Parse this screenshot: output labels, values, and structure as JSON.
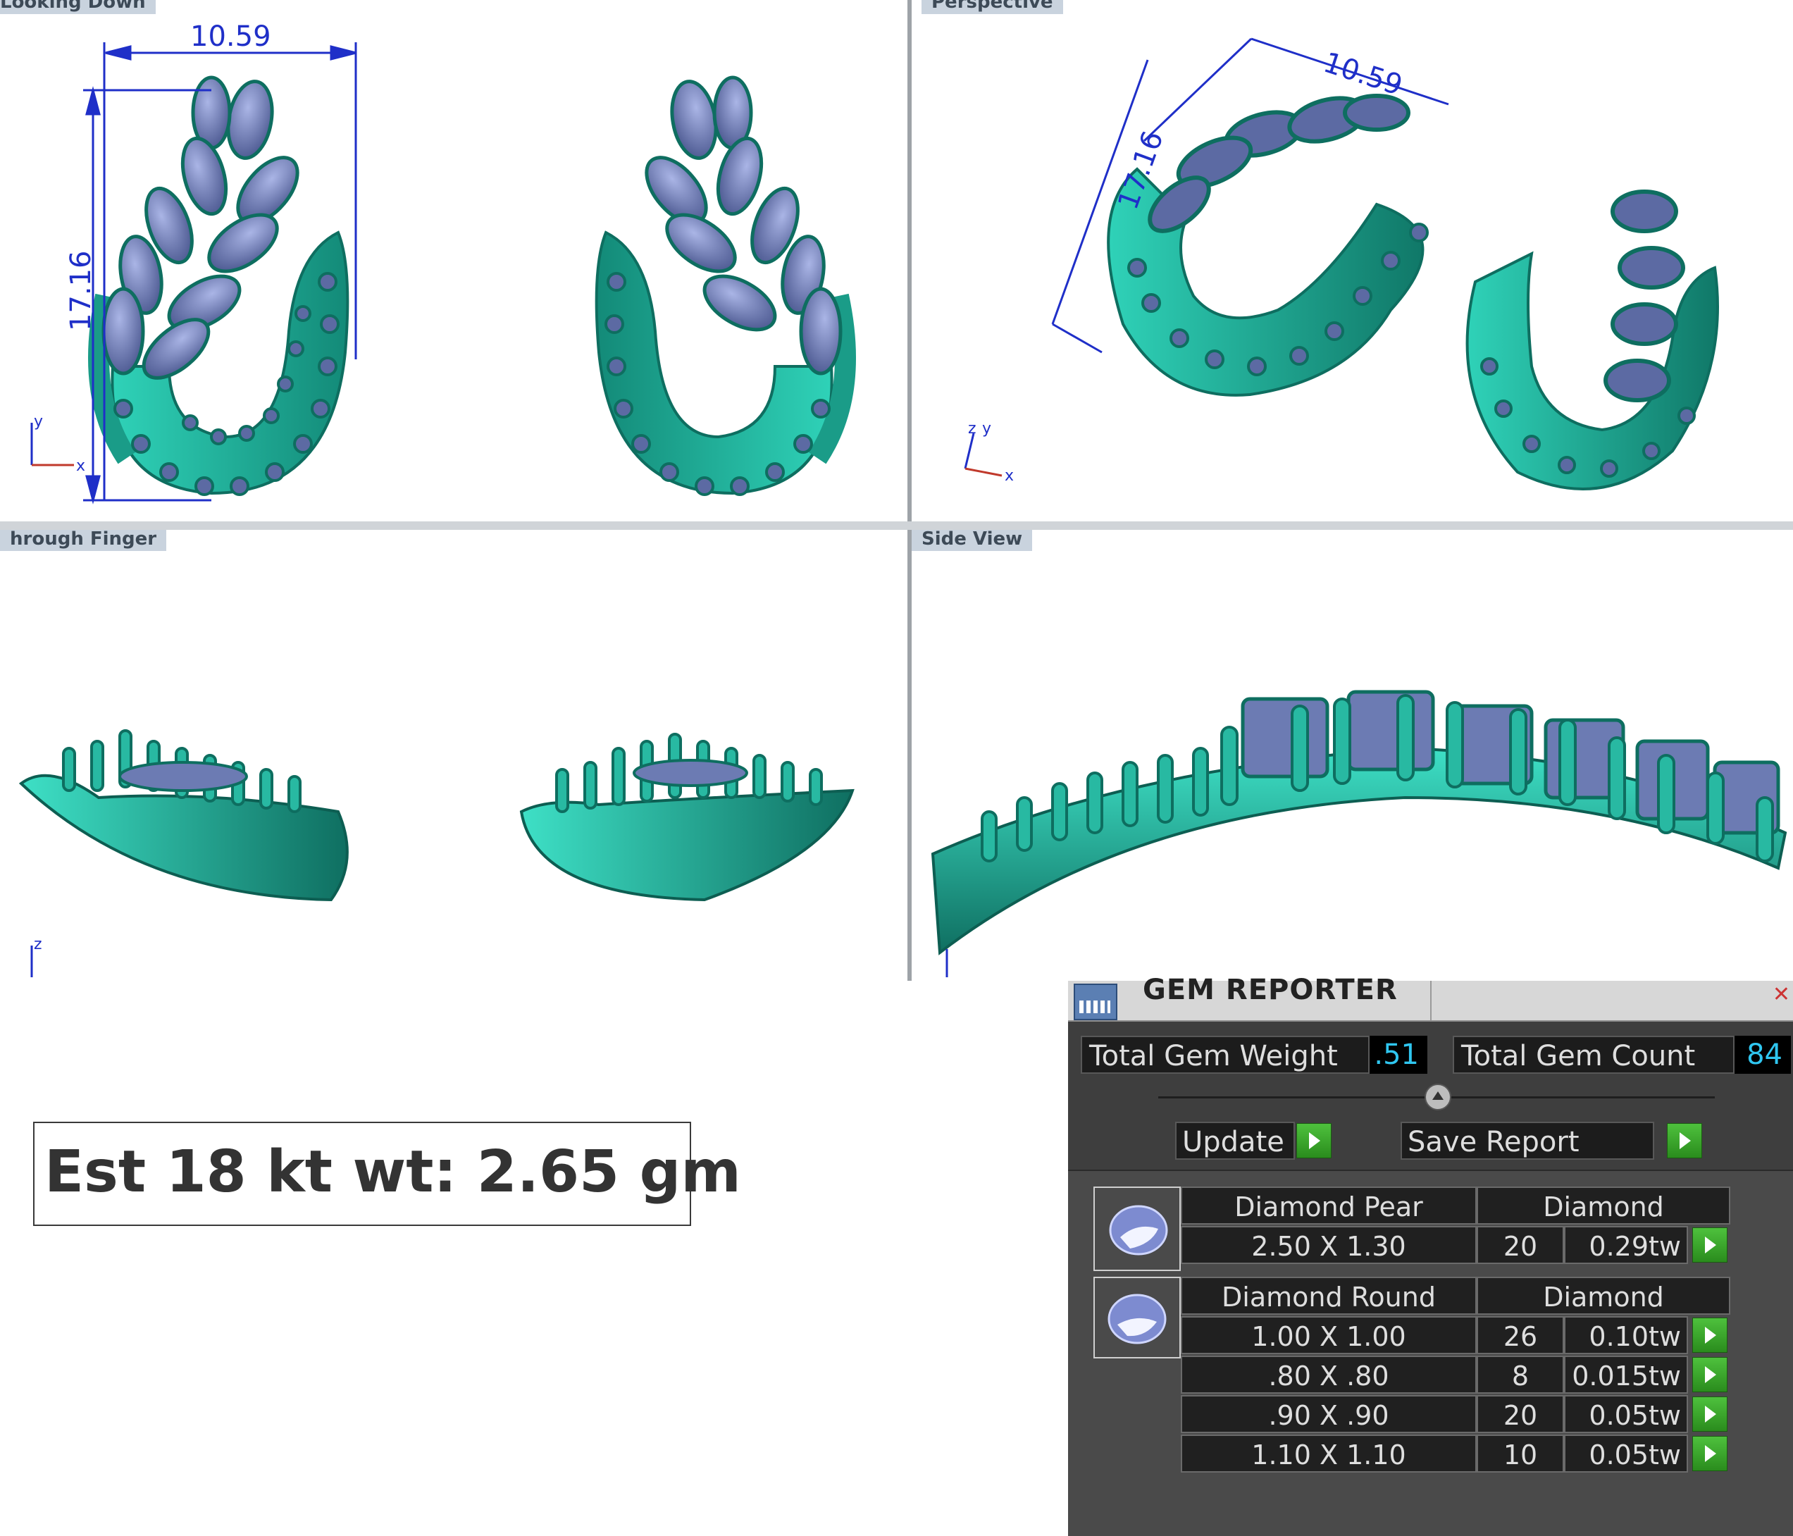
{
  "viewports": [
    {
      "id": "top-left",
      "label": "Looking Down"
    },
    {
      "id": "top-right",
      "label": "Perspective"
    },
    {
      "id": "bottom-left",
      "label": "hrough Finger"
    },
    {
      "id": "bottom-right",
      "label": "Side View"
    }
  ],
  "dimensions": {
    "width": "10.59",
    "height": "17.16"
  },
  "axes": {
    "x": "x",
    "y": "y",
    "z": "z"
  },
  "weight_text": "Est 18 kt wt: 2.65 gm",
  "gem_reporter": {
    "title": "GEM REPORTER",
    "total_weight_label": "Total Gem Weight",
    "total_weight_value": ".51",
    "total_count_label": "Total Gem Count",
    "total_count_value": "84",
    "update_label": "Update",
    "save_report_label": "Save Report",
    "groups": [
      {
        "name": "Diamond Pear",
        "material": "Diamond",
        "thumb": "pear-gem-icon",
        "rows": [
          {
            "size": "2.50 X 1.30",
            "count": "20",
            "weight": "0.29tw"
          }
        ]
      },
      {
        "name": "Diamond Round",
        "material": "Diamond",
        "thumb": "round-gem-icon",
        "rows": [
          {
            "size": "1.00 X 1.00",
            "count": "26",
            "weight": "0.10tw"
          },
          {
            "size": ".80 X .80",
            "count": "8",
            "weight": "0.015tw"
          },
          {
            "size": ".90 X .90",
            "count": "20",
            "weight": "0.05tw"
          },
          {
            "size": "1.10 X 1.10",
            "count": "10",
            "weight": "0.05tw"
          }
        ]
      }
    ]
  },
  "colors": {
    "metal": "#22b5a0",
    "metal_dark": "#0e6e60",
    "gem": "#6c7bb3",
    "dimension": "#1f2fc8",
    "panel_bg": "#3e3e3e",
    "value_text": "#2fc6f0"
  }
}
